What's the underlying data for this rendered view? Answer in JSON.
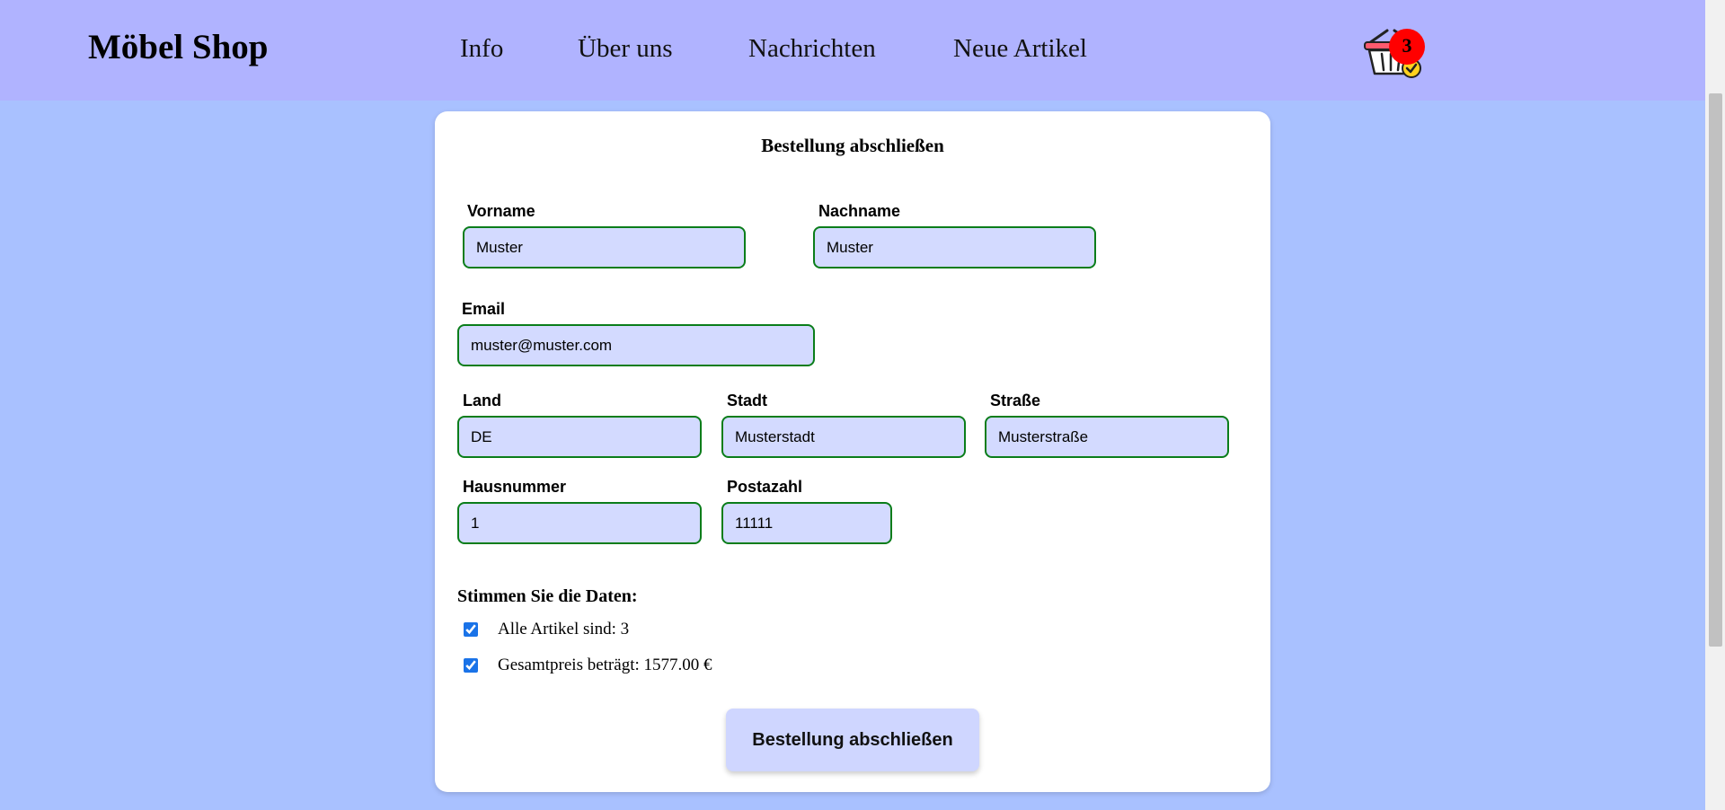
{
  "header": {
    "logo": "Möbel Shop",
    "nav": [
      "Info",
      "Über uns",
      "Nachrichten",
      "Neue Artikel"
    ],
    "cart_icon": "shopping-basket-icon",
    "cart_count": "3"
  },
  "form": {
    "title": "Bestellung abschließen",
    "fields": {
      "vorname": {
        "label": "Vorname",
        "value": "Muster"
      },
      "nachname": {
        "label": "Nachname",
        "value": "Muster"
      },
      "email": {
        "label": "Email",
        "value": "muster@muster.com"
      },
      "land": {
        "label": "Land",
        "value": "DE"
      },
      "stadt": {
        "label": "Stadt",
        "value": "Musterstadt"
      },
      "strasse": {
        "label": "Straße",
        "value": "Musterstraße"
      },
      "hausnummer": {
        "label": "Hausnummer",
        "value": "1"
      },
      "postazahl": {
        "label": "Postazahl",
        "value": "11111"
      }
    },
    "confirm_title": "Stimmen Sie die Daten:",
    "checks": [
      {
        "label": "Alle Artikel sind: 3",
        "checked": true
      },
      {
        "label": "Gesamtpreis beträgt: 1577.00 €",
        "checked": true
      }
    ],
    "submit_label": "Bestellung abschließen"
  },
  "colors": {
    "page_background": "#a9c1ff",
    "header_background": "#b0b3ff",
    "field_background": "#d3daff",
    "field_border": "#0a7d1a",
    "badge": "#ff0000"
  }
}
